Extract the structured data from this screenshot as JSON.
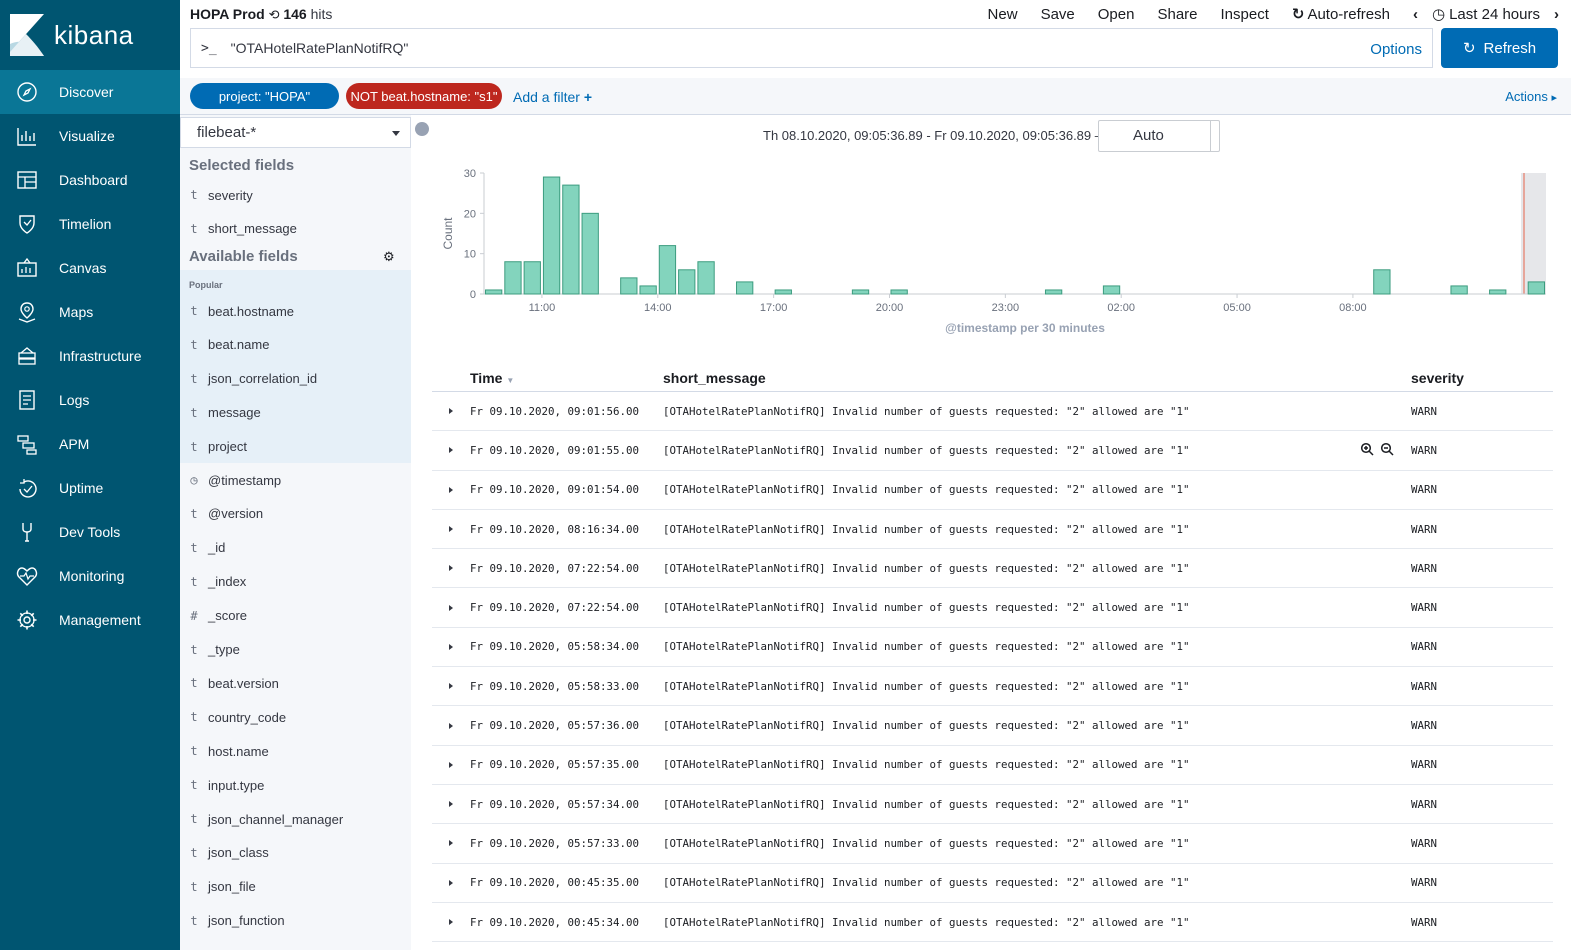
{
  "app": {
    "brand": "kibana"
  },
  "sidebar": {
    "items": [
      {
        "label": "Discover",
        "icon": "compass-icon"
      },
      {
        "label": "Visualize",
        "icon": "visualize-icon"
      },
      {
        "label": "Dashboard",
        "icon": "dashboard-icon"
      },
      {
        "label": "Timelion",
        "icon": "timelion-icon"
      },
      {
        "label": "Canvas",
        "icon": "canvas-icon"
      },
      {
        "label": "Maps",
        "icon": "maps-icon"
      },
      {
        "label": "Infrastructure",
        "icon": "infrastructure-icon"
      },
      {
        "label": "Logs",
        "icon": "logs-icon"
      },
      {
        "label": "APM",
        "icon": "apm-icon"
      },
      {
        "label": "Uptime",
        "icon": "uptime-icon"
      },
      {
        "label": "Dev Tools",
        "icon": "devtools-icon"
      },
      {
        "label": "Monitoring",
        "icon": "monitoring-icon"
      },
      {
        "label": "Management",
        "icon": "gear-icon"
      }
    ]
  },
  "header": {
    "search_name": "HOPA Prod",
    "hits_count": "146",
    "hits_label": "hits",
    "menu": {
      "new": "New",
      "save": "Save",
      "open": "Open",
      "share": "Share",
      "inspect": "Inspect",
      "auto_refresh": "Auto-refresh",
      "time_range": "Last 24 hours"
    },
    "query_prompt": ">_",
    "query": "\"OTAHotelRatePlanNotifRQ\"",
    "options": "Options",
    "refresh": "Refresh"
  },
  "filters": {
    "pills": [
      "project: \"HOPA\"",
      "NOT beat.hostname: \"s1\""
    ],
    "add_filter": "Add a filter",
    "actions": "Actions"
  },
  "fields": {
    "index_pattern": "filebeat-*",
    "selected_title": "Selected fields",
    "selected": [
      {
        "type": "t",
        "name": "severity"
      },
      {
        "type": "t",
        "name": "short_message"
      }
    ],
    "available_title": "Available fields",
    "popular_label": "Popular",
    "popular": [
      {
        "type": "t",
        "name": "beat.hostname"
      },
      {
        "type": "t",
        "name": "beat.name"
      },
      {
        "type": "t",
        "name": "json_correlation_id"
      },
      {
        "type": "t",
        "name": "message"
      },
      {
        "type": "t",
        "name": "project"
      }
    ],
    "others": [
      {
        "type": "◷",
        "name": "@timestamp"
      },
      {
        "type": "t",
        "name": "@version"
      },
      {
        "type": "t",
        "name": "_id"
      },
      {
        "type": "t",
        "name": "_index"
      },
      {
        "type": "#",
        "name": "_score"
      },
      {
        "type": "t",
        "name": "_type"
      },
      {
        "type": "t",
        "name": "beat.version"
      },
      {
        "type": "t",
        "name": "country_code"
      },
      {
        "type": "t",
        "name": "host.name"
      },
      {
        "type": "t",
        "name": "input.type"
      },
      {
        "type": "t",
        "name": "json_channel_manager"
      },
      {
        "type": "t",
        "name": "json_class"
      },
      {
        "type": "t",
        "name": "json_file"
      },
      {
        "type": "t",
        "name": "json_function"
      }
    ]
  },
  "histogram": {
    "range_text": "Th 08.10.2020, 09:05:36.89 - Fr 09.10.2020, 09:05:36.89 —",
    "interval": "Auto"
  },
  "chart_data": {
    "type": "bar",
    "xlabel": "@timestamp per 30 minutes",
    "ylabel": "Count",
    "ylim": [
      0,
      30
    ],
    "yticks": [
      0,
      10,
      20,
      30
    ],
    "xticks": [
      "11:00",
      "14:00",
      "17:00",
      "20:00",
      "23:00",
      "02:00",
      "05:00",
      "08:00"
    ],
    "bar_color": "#54b399",
    "x_start": "08.10.2020 09:30",
    "x_end": "09.10.2020 09:00",
    "bucket_minutes": 30,
    "values": [
      1,
      8,
      8,
      29,
      27,
      20,
      0,
      4,
      2,
      12,
      6,
      8,
      0,
      3,
      0,
      1,
      0,
      0,
      0,
      1,
      0,
      1,
      0,
      0,
      0,
      0,
      0,
      0,
      0,
      1,
      0,
      0,
      2,
      0,
      0,
      0,
      0,
      0,
      0,
      0,
      0,
      0,
      0,
      0,
      0,
      0,
      6,
      0,
      0,
      0,
      2,
      0,
      1,
      0,
      3
    ]
  },
  "table": {
    "headers": {
      "time": "Time",
      "message": "short_message",
      "severity": "severity"
    },
    "rows": [
      {
        "time": "Fr 09.10.2020, 09:01:56.00",
        "message": "[OTAHotelRatePlanNotifRQ] Invalid number of guests requested: \"2\" allowed are \"1\"",
        "severity": "WARN"
      },
      {
        "time": "Fr 09.10.2020, 09:01:55.00",
        "message": "[OTAHotelRatePlanNotifRQ] Invalid number of guests requested: \"2\" allowed are \"1\"",
        "severity": "WARN"
      },
      {
        "time": "Fr 09.10.2020, 09:01:54.00",
        "message": "[OTAHotelRatePlanNotifRQ] Invalid number of guests requested: \"2\" allowed are \"1\"",
        "severity": "WARN"
      },
      {
        "time": "Fr 09.10.2020, 08:16:34.00",
        "message": "[OTAHotelRatePlanNotifRQ] Invalid number of guests requested: \"2\" allowed are \"1\"",
        "severity": "WARN"
      },
      {
        "time": "Fr 09.10.2020, 07:22:54.00",
        "message": "[OTAHotelRatePlanNotifRQ] Invalid number of guests requested: \"2\" allowed are \"1\"",
        "severity": "WARN"
      },
      {
        "time": "Fr 09.10.2020, 07:22:54.00",
        "message": "[OTAHotelRatePlanNotifRQ] Invalid number of guests requested: \"2\" allowed are \"1\"",
        "severity": "WARN"
      },
      {
        "time": "Fr 09.10.2020, 05:58:34.00",
        "message": "[OTAHotelRatePlanNotifRQ] Invalid number of guests requested: \"2\" allowed are \"1\"",
        "severity": "WARN"
      },
      {
        "time": "Fr 09.10.2020, 05:58:33.00",
        "message": "[OTAHotelRatePlanNotifRQ] Invalid number of guests requested: \"2\" allowed are \"1\"",
        "severity": "WARN"
      },
      {
        "time": "Fr 09.10.2020, 05:57:36.00",
        "message": "[OTAHotelRatePlanNotifRQ] Invalid number of guests requested: \"2\" allowed are \"1\"",
        "severity": "WARN"
      },
      {
        "time": "Fr 09.10.2020, 05:57:35.00",
        "message": "[OTAHotelRatePlanNotifRQ] Invalid number of guests requested: \"2\" allowed are \"1\"",
        "severity": "WARN"
      },
      {
        "time": "Fr 09.10.2020, 05:57:34.00",
        "message": "[OTAHotelRatePlanNotifRQ] Invalid number of guests requested: \"2\" allowed are \"1\"",
        "severity": "WARN"
      },
      {
        "time": "Fr 09.10.2020, 05:57:33.00",
        "message": "[OTAHotelRatePlanNotifRQ] Invalid number of guests requested: \"2\" allowed are \"1\"",
        "severity": "WARN"
      },
      {
        "time": "Fr 09.10.2020, 00:45:35.00",
        "message": "[OTAHotelRatePlanNotifRQ] Invalid number of guests requested: \"2\" allowed are \"1\"",
        "severity": "WARN"
      },
      {
        "time": "Fr 09.10.2020, 00:45:34.00",
        "message": "[OTAHotelRatePlanNotifRQ] Invalid number of guests requested: \"2\" allowed are \"1\"",
        "severity": "WARN"
      }
    ]
  }
}
